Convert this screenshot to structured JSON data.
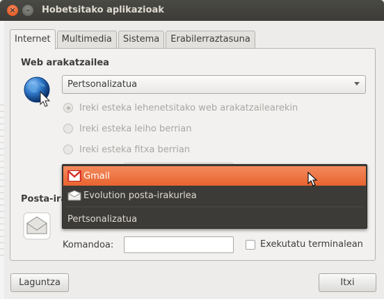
{
  "window": {
    "title": "Hobetsitako aplikazioak",
    "close_glyph": "×",
    "minimize_glyph": "–"
  },
  "tabs": [
    {
      "label": "Internet",
      "active": true
    },
    {
      "label": "Multimedia",
      "active": false
    },
    {
      "label": "Sistema",
      "active": false
    },
    {
      "label": "Erabilerraztasuna",
      "active": false
    }
  ],
  "web": {
    "section_title": "Web arakatzailea",
    "icon": "globe-icon",
    "selected_value": "Pertsonalizatua",
    "radio_options": [
      {
        "label": "Ireki esteka lehenetsitako web arakatzailearekin",
        "checked": true
      },
      {
        "label": "Ireki esteka leiho berrian",
        "checked": false
      },
      {
        "label": "Ireki esteka fitxa berrian",
        "checked": false
      }
    ]
  },
  "mail": {
    "section_title": "Posta-ira",
    "icon": "mail-icon",
    "command_label": "Komandoa:",
    "command_value": "",
    "terminal_label": "Exekutatu terminalean",
    "terminal_checked": false
  },
  "dropdown": {
    "items": [
      {
        "label": "Gmail",
        "icon": "gmail-icon",
        "highlighted": true
      },
      {
        "label": "Evolution posta-irakurlea",
        "icon": "evolution-icon",
        "highlighted": false
      },
      {
        "label": "Pertsonalizatua",
        "icon": "",
        "highlighted": false
      }
    ]
  },
  "buttons": {
    "help": "Laguntza",
    "close": "Itxi"
  },
  "colors": {
    "titlebar": "#3c3b37",
    "menu_bg": "#3c3b37",
    "highlight": "#e8642f",
    "window_bg": "#edeceb"
  }
}
